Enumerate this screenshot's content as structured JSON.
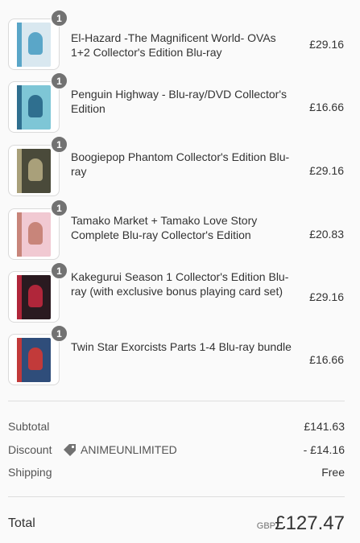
{
  "items": [
    {
      "qty": "1",
      "title": "El-Hazard -The Magnificent World- OVAs 1+2 Collector's Edition Blu-ray",
      "price": "£29.16",
      "thumb_icon": "el-hazard-cover",
      "color": "#d9e8f0",
      "accent": "#5aa6c8"
    },
    {
      "qty": "1",
      "title": "Penguin Highway - Blu-ray/DVD Collector's Edition",
      "price": "£16.66",
      "thumb_icon": "penguin-highway-cover",
      "color": "#7ec6d6",
      "accent": "#2f6f8f"
    },
    {
      "qty": "1",
      "title": "Boogiepop Phantom Collector's Edition Blu-ray",
      "price": "£29.16",
      "thumb_icon": "boogiepop-cover",
      "color": "#4a4a3a",
      "accent": "#a9a07a"
    },
    {
      "qty": "1",
      "title": "Tamako Market + Tamako Love Story Complete Blu-ray Collector's Edition",
      "price": "£20.83",
      "thumb_icon": "tamako-market-cover",
      "color": "#f1c9d2",
      "accent": "#c8857a"
    },
    {
      "qty": "1",
      "title": "Kakegurui Season 1 Collector's Edition Blu-ray (with exclusive bonus playing card set)",
      "price": "£29.16",
      "thumb_icon": "kakegurui-cover",
      "color": "#2a1a20",
      "accent": "#b0263a"
    },
    {
      "qty": "1",
      "title": "Twin Star Exorcists Parts 1-4 Blu-ray bundle",
      "price": "£16.66",
      "thumb_icon": "twin-star-exorcists-cover",
      "color": "#2f4d7a",
      "accent": "#c23a3a"
    }
  ],
  "summary": {
    "subtotal_label": "Subtotal",
    "subtotal_value": "£141.63",
    "discount_label": "Discount",
    "discount_code": "ANIMEUNLIMITED",
    "discount_value": "- £14.16",
    "shipping_label": "Shipping",
    "shipping_value": "Free",
    "total_label": "Total",
    "currency": "GBP",
    "total_value": "£127.47"
  }
}
